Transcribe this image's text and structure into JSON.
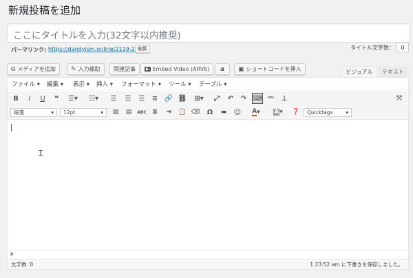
{
  "page": {
    "title": "新規投稿を追加"
  },
  "post": {
    "title_placeholder": "ここにタイトルを入力(32文字以内推奨)",
    "permalink_label": "パーマリンク:",
    "permalink_url": "https://dandyism.online/2119-2/",
    "edit_label": "編集",
    "title_count_label": "タイトル文字数：",
    "title_count_value": "0"
  },
  "media_buttons": [
    {
      "label": "メディアを追加",
      "icon": "media-icon"
    },
    {
      "label": "入力補助",
      "icon": "pen-icon"
    },
    {
      "label": "関連記事",
      "icon": ""
    },
    {
      "label": "Embed Video (ARVE)",
      "icon": "video-icon"
    },
    {
      "label": "",
      "icon": "amazon-icon"
    },
    {
      "label": "ショートコードを挿入",
      "icon": "shortcode-icon"
    }
  ],
  "tabs": {
    "visual": "ビジュアル",
    "text": "テキスト"
  },
  "menubar": [
    "ファイル",
    "編集",
    "表示",
    "挿入",
    "フォーマット",
    "ツール",
    "テーブル"
  ],
  "toolbar2": {
    "paragraph": "段落",
    "font_size": "12pt",
    "quicktags": "Quicktags"
  },
  "status": {
    "path": "P"
  },
  "footer": {
    "word_count": "文字数: 0",
    "save_status": "1:23:52 am に下書きを保存しました。"
  }
}
